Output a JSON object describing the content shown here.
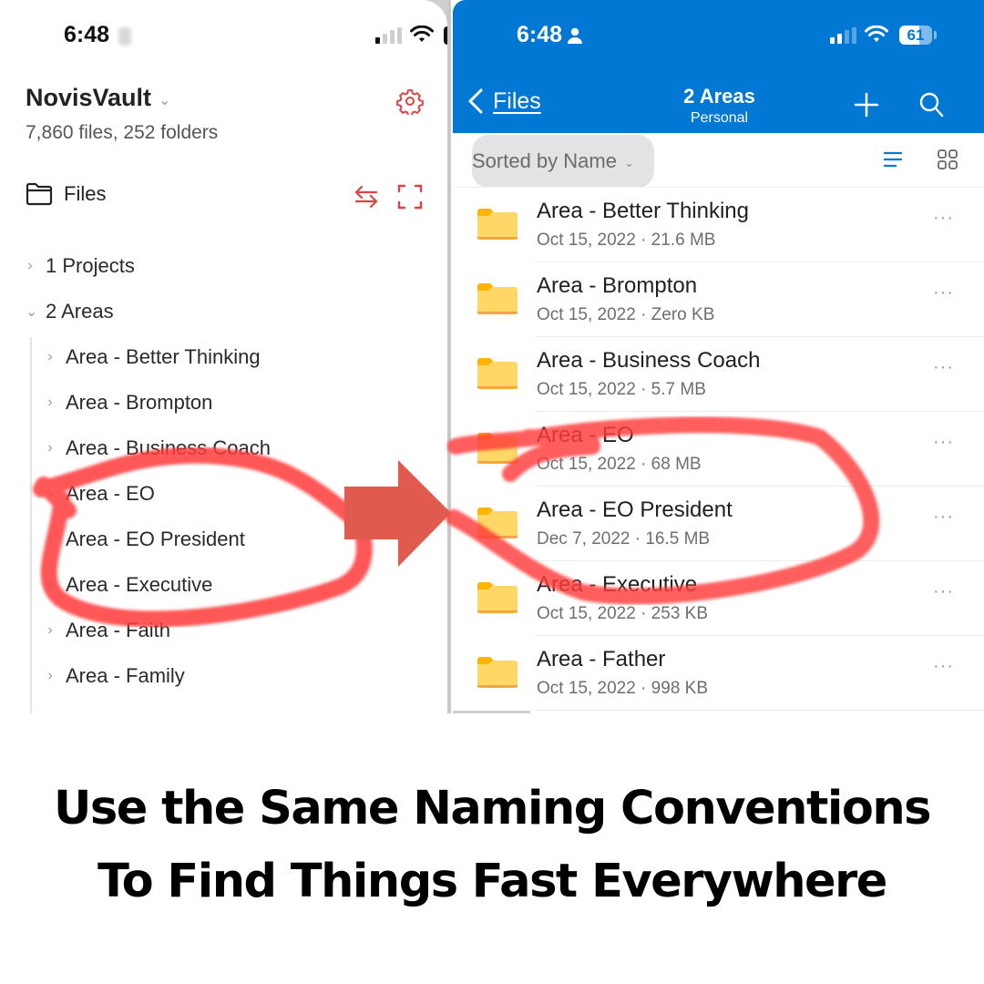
{
  "left_app": {
    "status_bar": {
      "time": "6:48"
    },
    "vault": {
      "name": "NovisVault",
      "stats": "7,860 files, 252 folders"
    },
    "section_label": "Files",
    "tree": [
      {
        "label": "1 Projects",
        "expanded": false,
        "level": 0
      },
      {
        "label": "2 Areas",
        "expanded": true,
        "level": 0
      },
      {
        "label": "Area - Better Thinking",
        "expanded": false,
        "level": 1
      },
      {
        "label": "Area - Brompton",
        "expanded": false,
        "level": 1
      },
      {
        "label": "Area - Business Coach",
        "expanded": false,
        "level": 1
      },
      {
        "label": "Area - EO",
        "expanded": false,
        "level": 1
      },
      {
        "label": "Area - EO President",
        "expanded": false,
        "level": 1
      },
      {
        "label": "Area - Executive",
        "expanded": false,
        "level": 1
      },
      {
        "label": "Area - Faith",
        "expanded": false,
        "level": 1
      },
      {
        "label": "Area - Family",
        "expanded": false,
        "level": 1
      }
    ],
    "icons": {
      "settings": "gear-icon",
      "sync": "swap-arrows-icon",
      "expand": "expand-icon",
      "folder": "folder-outline-icon"
    },
    "accent_color": "#d94545"
  },
  "right_app": {
    "status_bar": {
      "time": "6:48",
      "battery": "61"
    },
    "nav": {
      "back_label": "Files",
      "title": "2 Areas",
      "subtitle": "Personal"
    },
    "sort_label": "Sorted by Name",
    "files": [
      {
        "name": "Area - Better Thinking",
        "date": "Oct 15, 2022",
        "size": "21.6 MB",
        "meta": "Oct 15, 2022 · 21.6 MB"
      },
      {
        "name": "Area - Brompton",
        "date": "Oct 15, 2022",
        "size": "Zero KB",
        "meta": "Oct 15, 2022 · Zero KB"
      },
      {
        "name": "Area - Business Coach",
        "date": "Oct 15, 2022",
        "size": "5.7 MB",
        "meta": "Oct 15, 2022 · 5.7 MB"
      },
      {
        "name": "Area - EO",
        "date": "Oct 15, 2022",
        "size": "68 MB",
        "meta": "Oct 15, 2022 · 68 MB"
      },
      {
        "name": "Area - EO President",
        "date": "Dec 7, 2022",
        "size": "16.5 MB",
        "meta": "Dec 7, 2022 · 16.5 MB"
      },
      {
        "name": "Area - Executive",
        "date": "Oct 15, 2022",
        "size": "253 KB",
        "meta": "Oct 15, 2022 · 253 KB"
      },
      {
        "name": "Area - Father",
        "date": "Oct 15, 2022",
        "size": "998 KB",
        "meta": "Oct 15, 2022 · 998 KB"
      }
    ],
    "more_label": "···",
    "header_color": "#0078d4"
  },
  "annotation": {
    "arrow_color": "#e05a4e",
    "circle_color": "#ff3b3b",
    "highlighted": [
      "Area - EO",
      "Area - EO President",
      "Area - Executive"
    ]
  },
  "caption": {
    "line1": "Use the Same Naming Conventions",
    "line2": "To Find Things Fast Everywhere"
  }
}
